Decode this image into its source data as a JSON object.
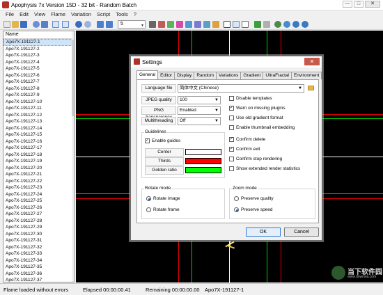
{
  "window": {
    "title": "Apophysis 7x Version 15D  - 32 bit - Random Batch",
    "buttons": [
      "—",
      "□",
      "✕"
    ]
  },
  "menu": [
    "File",
    "Edit",
    "View",
    "Flame",
    "Variation",
    "Script",
    "Tools",
    "?"
  ],
  "toolbar": {
    "zoom_combo": "5",
    "icons": [
      "new-icon",
      "open-icon",
      "save-icon",
      "render-icon",
      "randomize-icon",
      "list-view-icon",
      "undo-icon",
      "redo-icon",
      "view-icon",
      "gradient-icon",
      "mutate-icon",
      "adjust-icon",
      "editor-icon",
      "canvas-icon",
      "grid-icon",
      "transform-icon",
      "select-icon",
      "play-icon",
      "stop-icon",
      "zoom-in-icon",
      "zoom-out-icon"
    ]
  },
  "list": {
    "header": "Name",
    "items": [
      "Apo7X-191127-1",
      "Apo7X-191127-2",
      "Apo7X-191127-3",
      "Apo7X-191127-4",
      "Apo7X-191127-5",
      "Apo7X-191127-6",
      "Apo7X-191127-7",
      "Apo7X-191127-8",
      "Apo7X-191127-9",
      "Apo7X-191127-10",
      "Apo7X-191127-11",
      "Apo7X-191127-12",
      "Apo7X-191127-13",
      "Apo7X-191127-14",
      "Apo7X-191127-15",
      "Apo7X-191127-16",
      "Apo7X-191127-17",
      "Apo7X-191127-18",
      "Apo7X-191127-19",
      "Apo7X-191127-20",
      "Apo7X-191127-21",
      "Apo7X-191127-22",
      "Apo7X-191127-23",
      "Apo7X-191127-24",
      "Apo7X-191127-25",
      "Apo7X-191127-26",
      "Apo7X-191127-27",
      "Apo7X-191127-28",
      "Apo7X-191127-29",
      "Apo7X-191127-30",
      "Apo7X-191127-31",
      "Apo7X-191127-32",
      "Apo7X-191127-33",
      "Apo7X-191127-34",
      "Apo7X-191127-35",
      "Apo7X-191127-36",
      "Apo7X-191127-37"
    ],
    "selected_index": 0
  },
  "status": {
    "message": "Flame loaded without errors",
    "elapsed": "Elapsed 00:00:00.41",
    "remaining": "Remaining 00:00:00.00",
    "flame": "Apo7X-191127-1"
  },
  "dialog": {
    "title": "Settings",
    "close": "✕",
    "tabs": [
      "General",
      "Editor",
      "Display",
      "Random",
      "Variations",
      "Gradient",
      "UltraFractal",
      "Environment"
    ],
    "active_tab": 0,
    "language_label": "Language file",
    "language_value": "简体中文 (Chinese)",
    "jpeg_label": "JPEG quality",
    "jpeg_value": "100",
    "png_label": "PNG transparency",
    "png_value": "Enabled",
    "mt_label": "Multithreading",
    "mt_value": "Off",
    "guidelines_label": "Guidelines",
    "enable_guides": "Enable guides",
    "center_label": "Center",
    "thirds_label": "Thirds",
    "golden_label": "Golden ratio",
    "guide_colors": {
      "center": "#ffffff",
      "thirds": "#ff0000",
      "golden": "#00ff00"
    },
    "options": [
      {
        "label": "Disable templates",
        "checked": false
      },
      {
        "label": "Warn on missing plugins",
        "checked": true
      },
      {
        "label": "Use old gradient format",
        "checked": false
      },
      {
        "label": "Enable thumbnail embedding",
        "checked": false
      },
      {
        "label": "Confirm delete",
        "checked": true
      },
      {
        "label": "Confirm exit",
        "checked": true
      },
      {
        "label": "Confirm stop rendering",
        "checked": false
      },
      {
        "label": "Show extended render statistics",
        "checked": false
      }
    ],
    "rotate_mode_label": "Rotate mode",
    "rotate_image": "Rotate image",
    "rotate_frame": "Rotate frame",
    "zoom_mode_label": "Zoom mode",
    "preserve_quality": "Preserve quality",
    "preserve_speed": "Preserve speed",
    "ok": "OK",
    "cancel": "Cancel"
  },
  "watermark": {
    "text": "当下软件园",
    "sub": "www.downxia.com"
  }
}
